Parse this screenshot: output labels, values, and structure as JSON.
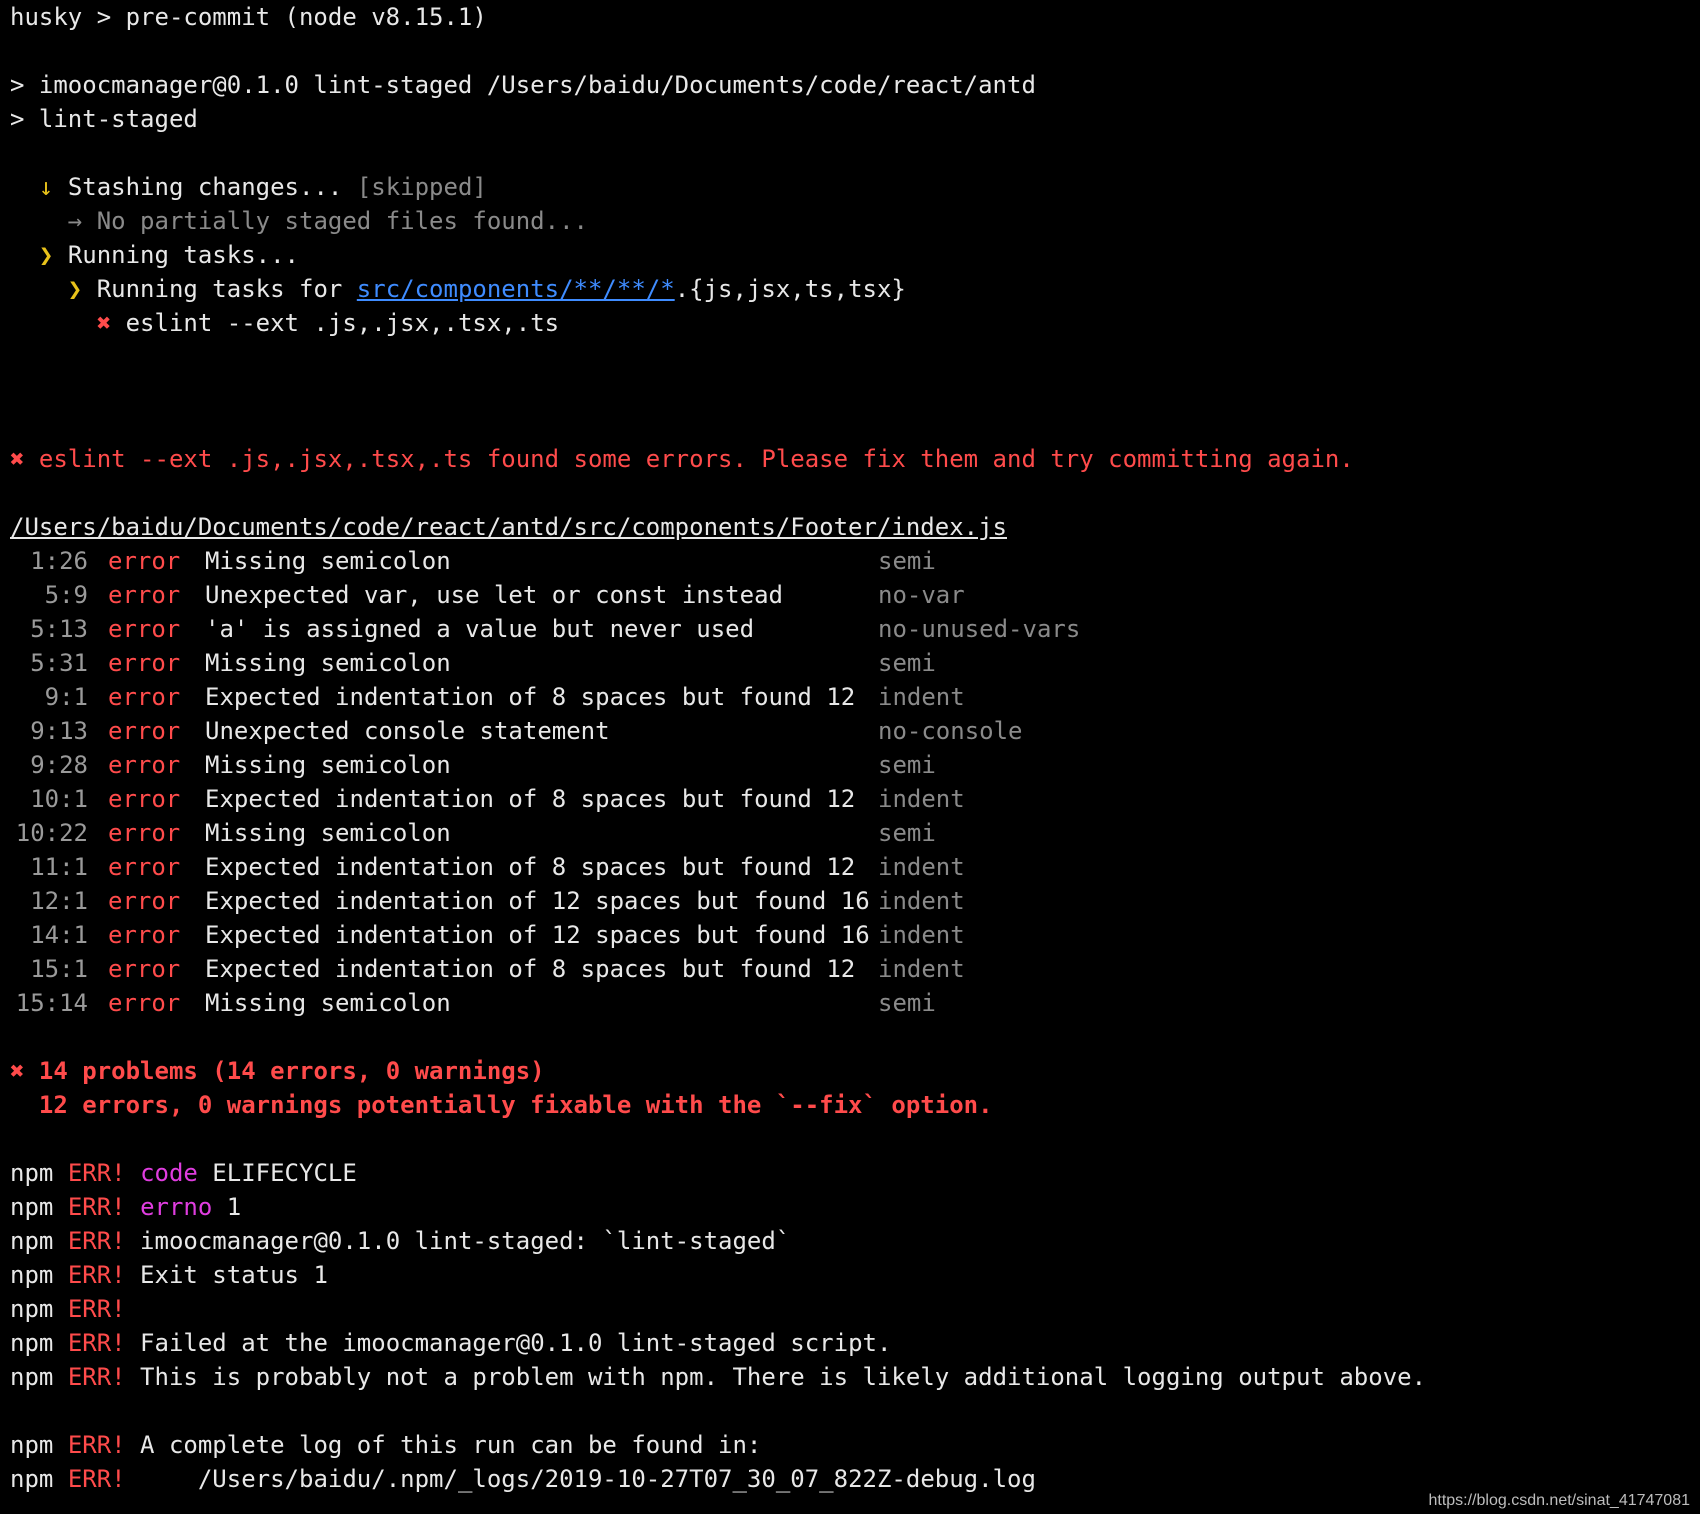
{
  "header": {
    "husky": "husky > pre-commit (node v8.15.1)",
    "cmd1": "> imoocmanager@0.1.0 lint-staged /Users/baidu/Documents/code/react/antd",
    "cmd2": "> lint-staged"
  },
  "tasks": {
    "stash_arrow": "↓",
    "stash": "Stashing changes...",
    "skipped": "[skipped]",
    "no_partial_arrow": "→",
    "no_partial": "No partially staged files found...",
    "running_arrow": "❯",
    "running": "Running tasks...",
    "running_for_arrow": "❯",
    "running_for_prefix": "Running tasks for",
    "glob_link": "src/components/**/**/*",
    "glob_suffix": ".{js,jsx,ts,tsx}",
    "x": "✖",
    "eslint_cmd": "eslint --ext .js,.jsx,.tsx,.ts"
  },
  "summary_error": {
    "x": "✖",
    "text": "eslint --ext .js,.jsx,.tsx,.ts found some errors. Please fix them and try committing again."
  },
  "file_path": "/Users/baidu/Documents/code/react/antd/src/components/Footer/index.js",
  "errors": [
    {
      "loc": "1:26",
      "sev": "error",
      "msg": "Missing semicolon",
      "rule": "semi"
    },
    {
      "loc": "5:9",
      "sev": "error",
      "msg": "Unexpected var, use let or const instead",
      "rule": "no-var"
    },
    {
      "loc": "5:13",
      "sev": "error",
      "msg": "'a' is assigned a value but never used",
      "rule": "no-unused-vars"
    },
    {
      "loc": "5:31",
      "sev": "error",
      "msg": "Missing semicolon",
      "rule": "semi"
    },
    {
      "loc": "9:1",
      "sev": "error",
      "msg": "Expected indentation of 8 spaces but found 12",
      "rule": "indent"
    },
    {
      "loc": "9:13",
      "sev": "error",
      "msg": "Unexpected console statement",
      "rule": "no-console"
    },
    {
      "loc": "9:28",
      "sev": "error",
      "msg": "Missing semicolon",
      "rule": "semi"
    },
    {
      "loc": "10:1",
      "sev": "error",
      "msg": "Expected indentation of 8 spaces but found 12",
      "rule": "indent"
    },
    {
      "loc": "10:22",
      "sev": "error",
      "msg": "Missing semicolon",
      "rule": "semi"
    },
    {
      "loc": "11:1",
      "sev": "error",
      "msg": "Expected indentation of 8 spaces but found 12",
      "rule": "indent"
    },
    {
      "loc": "12:1",
      "sev": "error",
      "msg": "Expected indentation of 12 spaces but found 16",
      "rule": "indent"
    },
    {
      "loc": "14:1",
      "sev": "error",
      "msg": "Expected indentation of 12 spaces but found 16",
      "rule": "indent"
    },
    {
      "loc": "15:1",
      "sev": "error",
      "msg": "Expected indentation of 8 spaces but found 12",
      "rule": "indent"
    },
    {
      "loc": "15:14",
      "sev": "error",
      "msg": "Missing semicolon",
      "rule": "semi"
    }
  ],
  "problems": {
    "x": "✖",
    "line1": "14 problems (14 errors, 0 warnings)",
    "line2": "  12 errors, 0 warnings potentially fixable with the `--fix` option."
  },
  "npm": [
    {
      "prefix": "npm",
      "err": "ERR!",
      "key": "code",
      "text": " ELIFECYCLE"
    },
    {
      "prefix": "npm",
      "err": "ERR!",
      "key": "errno",
      "text": " 1"
    },
    {
      "prefix": "npm",
      "err": "ERR!",
      "key": "",
      "text": " imoocmanager@0.1.0 lint-staged: `lint-staged`"
    },
    {
      "prefix": "npm",
      "err": "ERR!",
      "key": "",
      "text": " Exit status 1"
    },
    {
      "prefix": "npm",
      "err": "ERR!",
      "key": "",
      "text": ""
    },
    {
      "prefix": "npm",
      "err": "ERR!",
      "key": "",
      "text": " Failed at the imoocmanager@0.1.0 lint-staged script."
    },
    {
      "prefix": "npm",
      "err": "ERR!",
      "key": "",
      "text": " This is probably not a problem with npm. There is likely additional logging output above."
    },
    {
      "blank": true
    },
    {
      "prefix": "npm",
      "err": "ERR!",
      "key": "",
      "text": " A complete log of this run can be found in:"
    },
    {
      "prefix": "npm",
      "err": "ERR!",
      "key": "",
      "text": "     /Users/baidu/.npm/_logs/2019-10-27T07_30_07_822Z-debug.log"
    }
  ],
  "watermark": "https://blog.csdn.net/sinat_41747081"
}
